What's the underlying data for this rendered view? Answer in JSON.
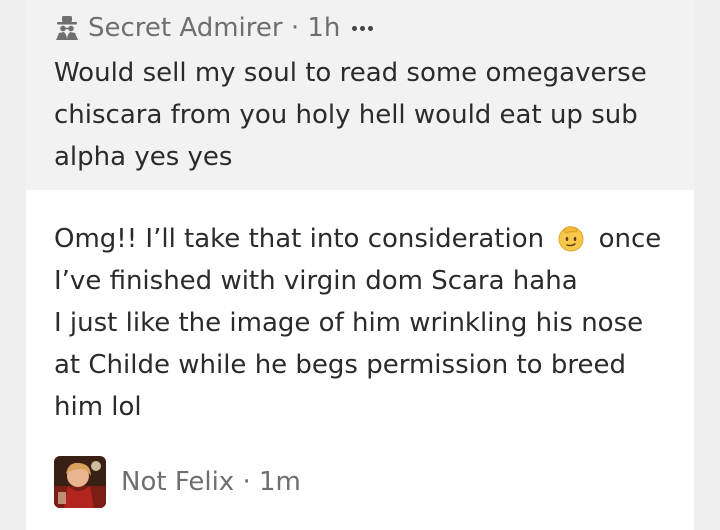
{
  "question": {
    "icon": "spy-incognito-icon",
    "author": "Secret Admirer",
    "separator": "·",
    "time": "1h",
    "more_icon": "more-dots-icon",
    "text": "Would sell my soul to read some omegaverse chiscara from you holy hell would eat up sub alpha yes yes"
  },
  "answer": {
    "line1_before_emoji": "Omg!! I’ll take that into consideration",
    "emoji": "saluting-face-icon",
    "line1_after_emoji": "once",
    "line2": "I’ve finished with virgin dom Scara haha",
    "line3": "I just like the image of him wrinkling his nose",
    "line4": "at Childe while he begs permission to breed",
    "line5": "him lol"
  },
  "comment": {
    "avatar": "user-avatar",
    "author": "Not Felix",
    "separator": "·",
    "time": "1m"
  },
  "colors": {
    "page_bg": "#efefef",
    "question_bg": "#f2f2f2",
    "card_bg": "#ffffff",
    "meta_text": "#6f6f6f",
    "body_text": "#2b2b2b"
  }
}
